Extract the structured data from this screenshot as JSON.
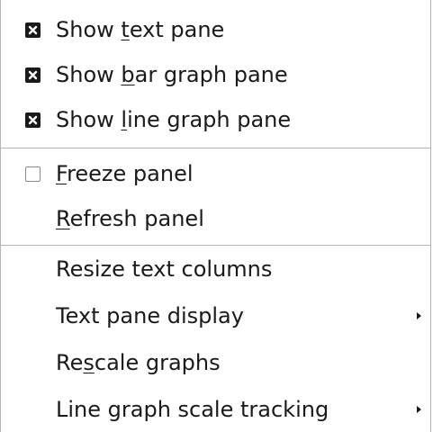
{
  "menu": {
    "items": [
      {
        "type": "check",
        "checked": true,
        "pre": "Show ",
        "mnemonic": "t",
        "post": "ext pane"
      },
      {
        "type": "check",
        "checked": true,
        "pre": "Show ",
        "mnemonic": "b",
        "post": "ar graph pane"
      },
      {
        "type": "check",
        "checked": true,
        "pre": "Show ",
        "mnemonic": "l",
        "post": "ine graph pane"
      },
      {
        "type": "check",
        "checked": false,
        "pre": "",
        "mnemonic": "F",
        "post": "reeze panel"
      },
      {
        "type": "action",
        "pre": "",
        "mnemonic": "R",
        "post": "efresh panel"
      },
      {
        "type": "action",
        "pre": "Resize text columns",
        "mnemonic": "",
        "post": ""
      },
      {
        "type": "submenu",
        "pre": "Text pane display",
        "mnemonic": "",
        "post": ""
      },
      {
        "type": "action",
        "pre": "Re",
        "mnemonic": "s",
        "post": "cale graphs"
      },
      {
        "type": "submenu",
        "pre": "Line graph scale tracking",
        "mnemonic": "",
        "post": ""
      }
    ],
    "icons": {
      "checked": "checkbox-checked-icon",
      "unchecked": "checkbox-unchecked-icon",
      "submenu": "submenu-arrow-icon"
    },
    "colors": {
      "text": "#1a1a1a",
      "background": "#ffffff",
      "separator": "#b4b4b4"
    }
  }
}
